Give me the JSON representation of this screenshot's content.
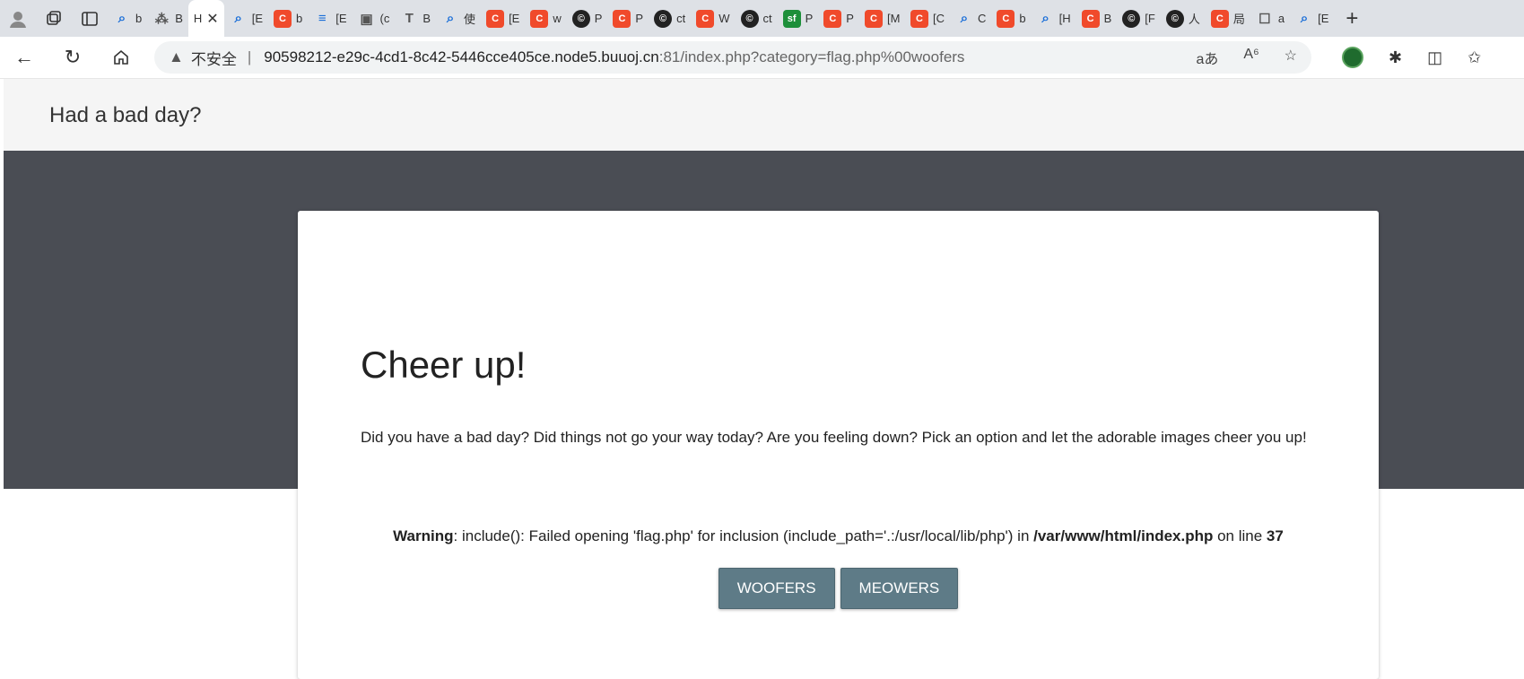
{
  "browser": {
    "tabs": [
      {
        "icon": "search",
        "label": "b"
      },
      {
        "icon": "red-text",
        "label": "B"
      },
      {
        "icon": "none",
        "label": "H",
        "active": true
      },
      {
        "icon": "search",
        "label": "[E"
      },
      {
        "icon": "red-c",
        "label": "b"
      },
      {
        "icon": "blue-layers",
        "label": "[E"
      },
      {
        "icon": "photo",
        "label": "(c"
      },
      {
        "icon": "green-t",
        "label": "B"
      },
      {
        "icon": "search",
        "label": "使"
      },
      {
        "icon": "red-c",
        "label": "[E"
      },
      {
        "icon": "red-c",
        "label": "w"
      },
      {
        "icon": "dark-circle",
        "label": "P"
      },
      {
        "icon": "red-c",
        "label": "P"
      },
      {
        "icon": "dark-circle",
        "label": "ct"
      },
      {
        "icon": "red-c",
        "label": "W"
      },
      {
        "icon": "dark-circle",
        "label": "ct"
      },
      {
        "icon": "sf",
        "label": "P"
      },
      {
        "icon": "red-c",
        "label": "P"
      },
      {
        "icon": "red-c",
        "label": "[M"
      },
      {
        "icon": "red-c",
        "label": "[C"
      },
      {
        "icon": "search",
        "label": "C"
      },
      {
        "icon": "red-c",
        "label": "b"
      },
      {
        "icon": "search",
        "label": "[H"
      },
      {
        "icon": "red-c",
        "label": "B"
      },
      {
        "icon": "dark-circle",
        "label": "[F"
      },
      {
        "icon": "dark-circle",
        "label": "人"
      },
      {
        "icon": "red-c",
        "label": "局"
      },
      {
        "icon": "doc",
        "label": "a"
      },
      {
        "icon": "search",
        "label": "[E"
      }
    ],
    "address": {
      "security_label": "不安全",
      "host": "90598212-e29c-4cd1-8c42-5446cce405ce.node5.buuoj.cn",
      "path": ":81/index.php?category=flag.php%00woofers"
    }
  },
  "site": {
    "title": "Had a bad day?",
    "heading": "Cheer up!",
    "description": "Did you have a bad day? Did things not go your way today? Are you feeling down? Pick an option and let the adorable images cheer you up!",
    "warning": {
      "label": "Warning",
      "text": ": include(): Failed opening 'flag.php' for inclusion (include_path='.:/usr/local/lib/php') in ",
      "file": "/var/www/html/index.php",
      "on_line": " on line ",
      "line": "37"
    },
    "buttons": {
      "woofers": "WOOFERS",
      "meowers": "MEOWERS"
    }
  }
}
